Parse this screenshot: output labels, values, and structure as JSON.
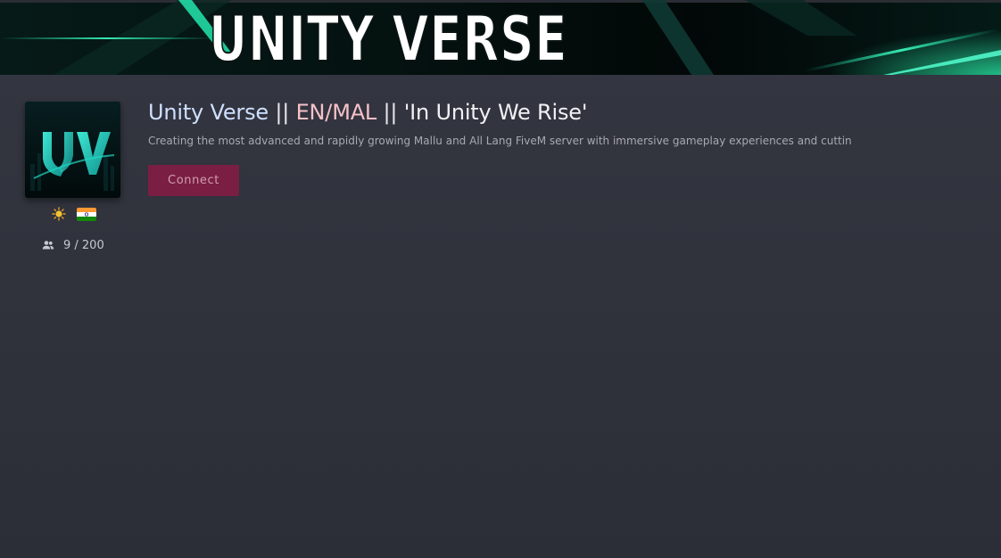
{
  "banner": {
    "title": "UNITY VERSE"
  },
  "server": {
    "title_name": "Unity Verse",
    "title_sep1": " || ",
    "title_lang": "EN/MAL",
    "title_sep2": " || ",
    "title_tagline": "'In Unity We Rise'",
    "description": "Creating the most advanced and rapidly growing Mallu and All Lang FiveM server with immersive gameplay experiences and cuttin",
    "connect_label": "Connect",
    "players": "9 / 200",
    "logo_letters": "UV",
    "icons": {
      "weather": "sun-icon",
      "country": "india-flag-icon",
      "players": "players-icon"
    }
  },
  "colors": {
    "accent_teal": "#19e0a6",
    "connect_button": "#7b1e43",
    "background": "#2f313b"
  }
}
